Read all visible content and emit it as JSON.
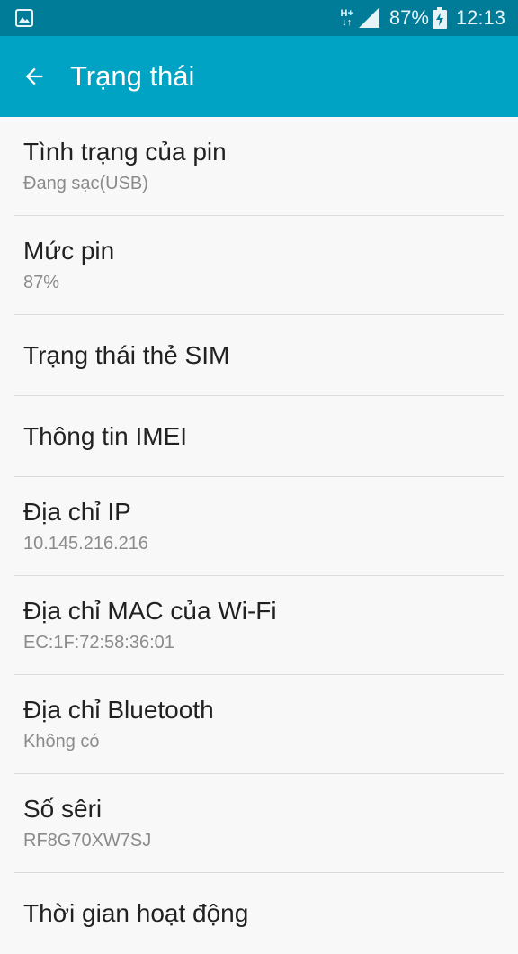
{
  "status_bar": {
    "net_type_top": "H+",
    "net_type_bottom": "↓↑",
    "battery_percent": "87%",
    "time": "12:13"
  },
  "app_bar": {
    "title": "Trạng thái",
    "back_icon": "arrow-back-icon"
  },
  "items": [
    {
      "title": "Tình trạng của pin",
      "subtitle": "Đang sạc(USB)"
    },
    {
      "title": "Mức pin",
      "subtitle": "87%"
    },
    {
      "title": "Trạng thái thẻ SIM"
    },
    {
      "title": "Thông tin IMEI"
    },
    {
      "title": "Địa chỉ IP",
      "subtitle": "10.145.216.216"
    },
    {
      "title": "Địa chỉ MAC của Wi-Fi",
      "subtitle": "EC:1F:72:58:36:01"
    },
    {
      "title": "Địa chỉ Bluetooth",
      "subtitle": "Không có"
    },
    {
      "title": "Số sêri",
      "subtitle": "RF8G70XW7SJ"
    },
    {
      "title": "Thời gian hoạt động"
    }
  ],
  "colors": {
    "status_bar": "#007c99",
    "app_bar": "#00a3c3",
    "background": "#f8f8f8"
  }
}
